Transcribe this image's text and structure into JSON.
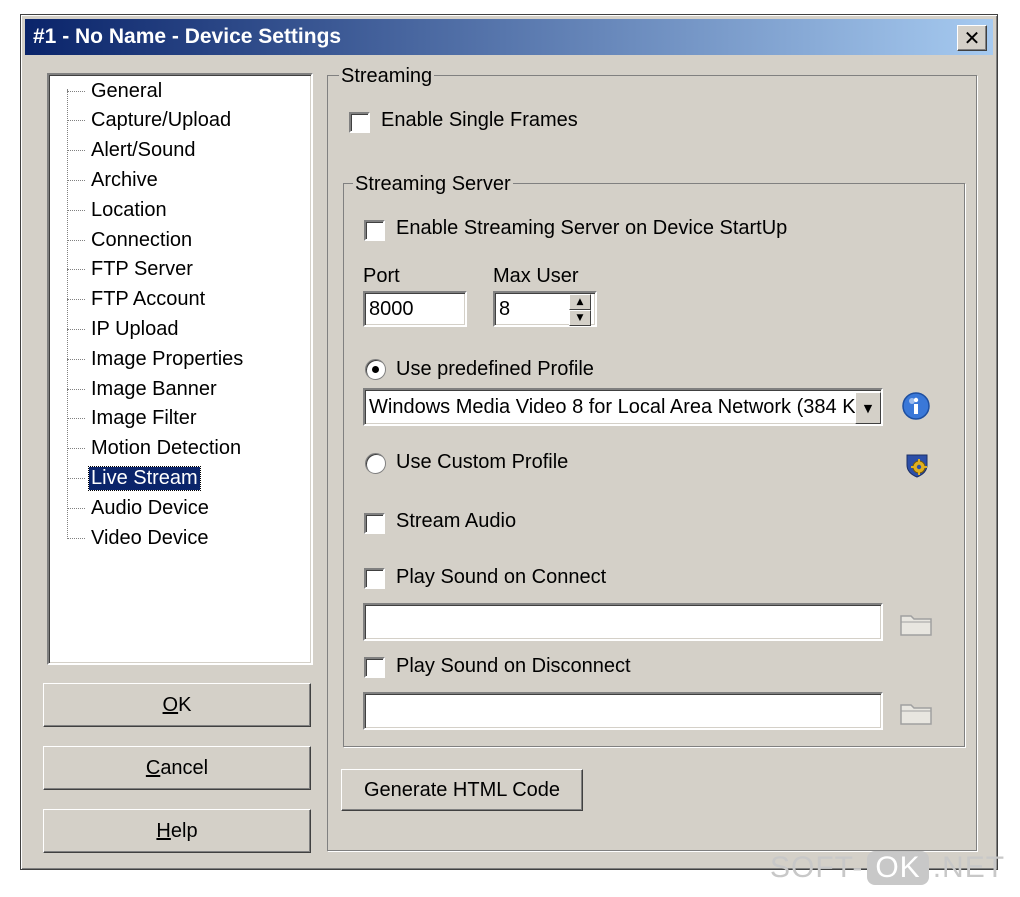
{
  "window": {
    "title": "#1 - No Name - Device Settings",
    "close_glyph": "✕"
  },
  "tree": {
    "items": [
      "General",
      "Capture/Upload",
      "Alert/Sound",
      "Archive",
      "Location",
      "Connection",
      "FTP Server",
      "FTP Account",
      "IP Upload",
      "Image Properties",
      "Image Banner",
      "Image Filter",
      "Motion Detection",
      "Live Stream",
      "Audio Device",
      "Video Device"
    ],
    "selected": "Live Stream"
  },
  "buttons": {
    "ok": {
      "label": "OK",
      "mnemonic": "O",
      "rest": "K"
    },
    "cancel": {
      "label": "Cancel",
      "mnemonic": "C",
      "rest": "ancel"
    },
    "help": {
      "label": "Help",
      "mnemonic": "H",
      "rest": "elp"
    },
    "generate_html": "Generate HTML Code"
  },
  "streaming": {
    "group_title": "Streaming",
    "enable_single_frames": {
      "label": "Enable Single Frames",
      "checked": false
    },
    "server": {
      "group_title": "Streaming Server",
      "enable_on_startup": {
        "label": "Enable Streaming Server on Device StartUp",
        "checked": false
      },
      "port": {
        "label": "Port",
        "value": "8000"
      },
      "max_user": {
        "label": "Max User",
        "value": "8"
      },
      "predefined_profile": {
        "label": "Use predefined Profile",
        "selected": true
      },
      "profile_combo": {
        "value": "Windows Media Video 8 for Local Area Network (384 K"
      },
      "custom_profile": {
        "label": "Use Custom Profile",
        "selected": false
      },
      "stream_audio": {
        "label": "Stream Audio",
        "checked": false
      },
      "play_sound_connect": {
        "label": "Play Sound on Connect",
        "checked": false,
        "path": ""
      },
      "play_sound_disconnect": {
        "label": "Play Sound on Disconnect",
        "checked": false,
        "path": ""
      }
    }
  },
  "icons": {
    "info": "info-icon",
    "custom_profile_settings": "settings-shield-icon",
    "browse": "folder-icon"
  },
  "watermark": {
    "left": "SOFT-",
    "boxed": "OK",
    "right": ".NET"
  },
  "colors": {
    "titlebar_start": "#0a246a",
    "titlebar_end": "#a6caf0",
    "face": "#d4d0c8",
    "selection": "#0a246a"
  }
}
